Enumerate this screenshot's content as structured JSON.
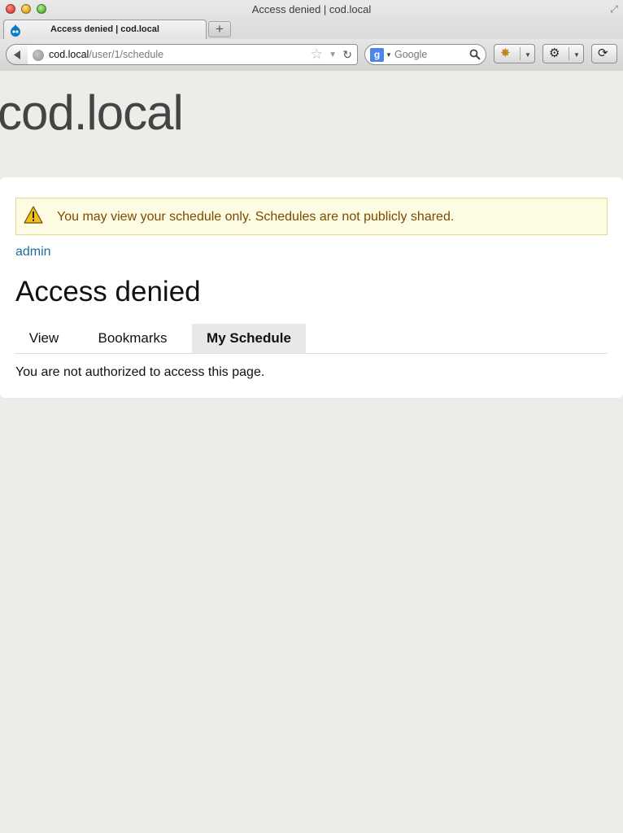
{
  "window": {
    "title": "Access denied | cod.local"
  },
  "tab": {
    "title": "Access denied | cod.local",
    "new_tab_label": "+"
  },
  "address_bar": {
    "host": "cod.local",
    "path": "/user/1/schedule"
  },
  "search_bar": {
    "engine_letter": "g",
    "placeholder": "Google"
  },
  "site": {
    "name": "cod.local"
  },
  "message": {
    "warning_text": "You may view your schedule only. Schedules are not publicly shared."
  },
  "user_link": "admin",
  "page": {
    "title": "Access denied",
    "body": "You are not authorized to access this page."
  },
  "tabs": [
    {
      "label": "View",
      "active": false
    },
    {
      "label": "Bookmarks",
      "active": false
    },
    {
      "label": "My Schedule",
      "active": true
    }
  ],
  "colors": {
    "page_bg": "#eeece8",
    "warning_bg": "#fefbe3",
    "warning_text": "#7a4b00",
    "link": "#1f6ba0"
  }
}
